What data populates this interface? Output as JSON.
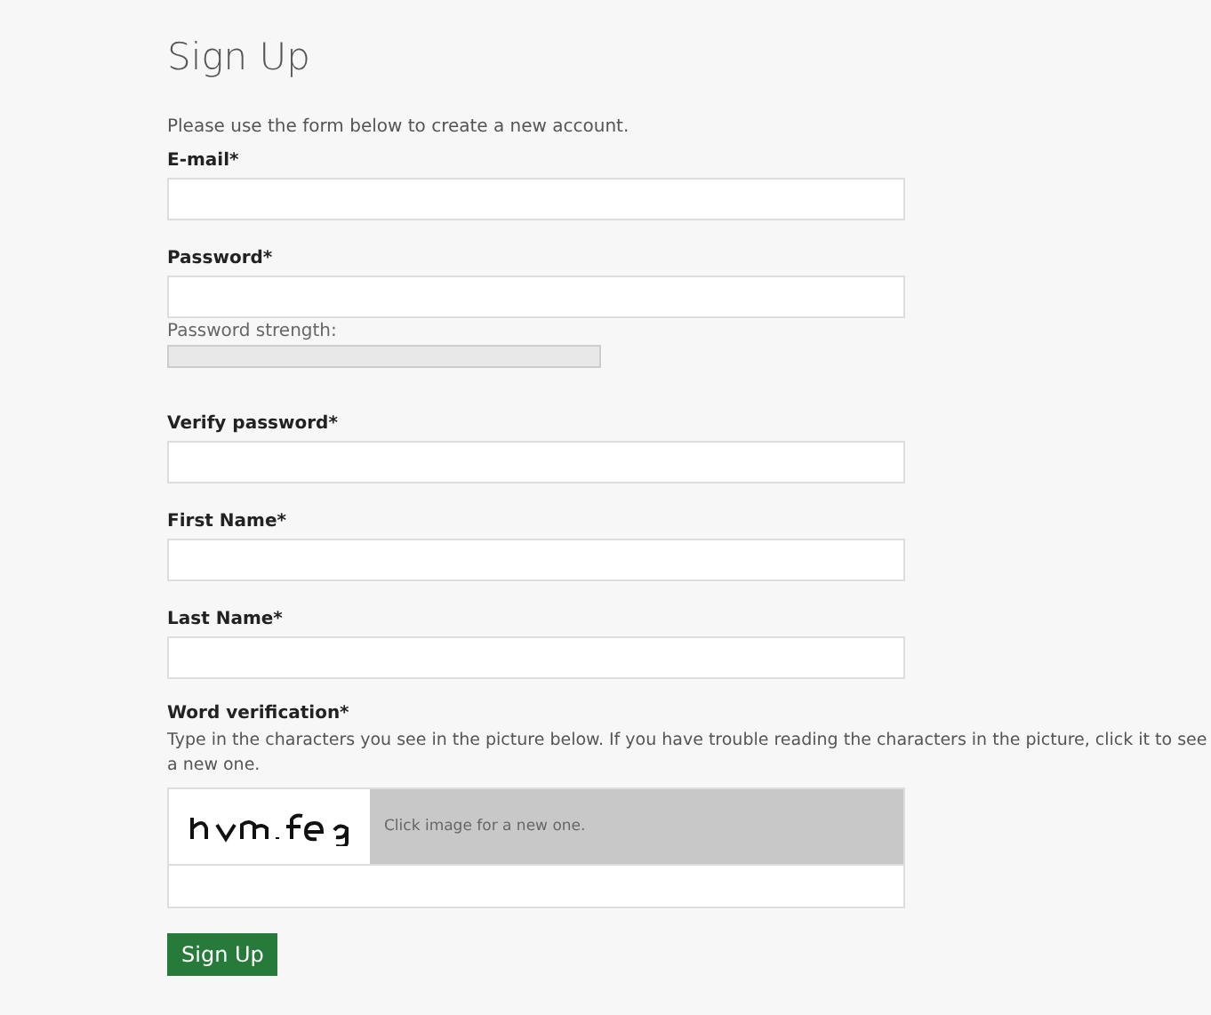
{
  "title": "Sign Up",
  "intro": "Please use the form below to create a new account.",
  "fields": [
    {
      "label": "E-mail*"
    },
    {
      "label": "Password*",
      "strength_label": "Password strength:",
      "level": 0
    },
    {
      "label": "Verify password*"
    },
    {
      "label": "First Name*"
    },
    {
      "label": "Last Name*"
    }
  ],
  "verification": {
    "label": "Word verification*",
    "help": "Type in the characters you see in the picture below. If you have trouble reading the characters in the picture, click it to see a new one.",
    "hint": "Click image for a new one."
  },
  "submit": "Sign Up"
}
